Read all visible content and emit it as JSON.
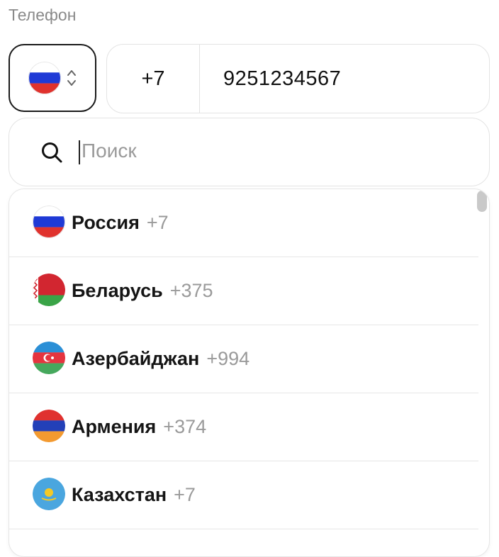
{
  "field_label": "Телефон",
  "selected_country": {
    "flag": "russia-flag-icon"
  },
  "phone": {
    "code": "+7",
    "number": "9251234567"
  },
  "search": {
    "placeholder": "Поиск",
    "icon": "search-icon"
  },
  "countries": [
    {
      "name": "Россия",
      "code": "+7",
      "flag": "russia-flag-icon"
    },
    {
      "name": "Беларусь",
      "code": "+375",
      "flag": "belarus-flag-icon"
    },
    {
      "name": "Азербайджан",
      "code": "+994",
      "flag": "azerbaijan-flag-icon"
    },
    {
      "name": "Армения",
      "code": "+374",
      "flag": "armenia-flag-icon"
    },
    {
      "name": "Казахстан",
      "code": "+7",
      "flag": "kazakhstan-flag-icon"
    }
  ],
  "colors": {
    "text": "#111111",
    "muted": "#9a9a9a",
    "border": "#e3e3e3",
    "active_border": "#1a1a1a"
  }
}
